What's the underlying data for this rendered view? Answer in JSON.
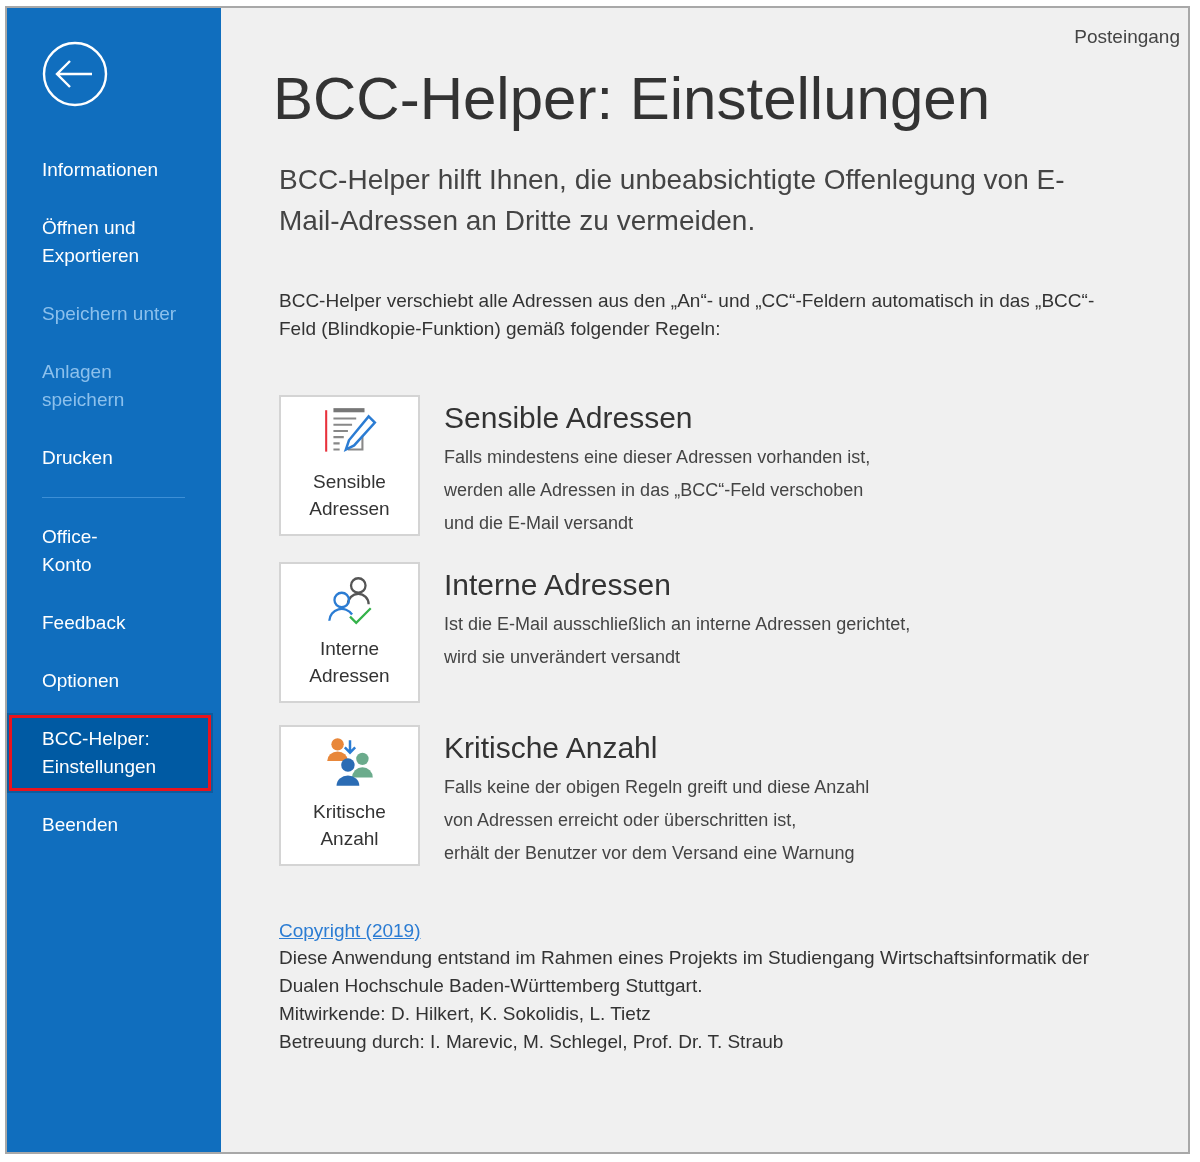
{
  "sidebar": {
    "items": [
      {
        "kind": "item",
        "label": "Informationen",
        "disabled": false,
        "selected": false
      },
      {
        "kind": "item",
        "label": "Öffnen und\nExportieren",
        "disabled": false,
        "selected": false
      },
      {
        "kind": "item",
        "label": "Speichern unter",
        "disabled": true,
        "selected": false
      },
      {
        "kind": "item",
        "label": "Anlagen\nspeichern",
        "disabled": true,
        "selected": false
      },
      {
        "kind": "item",
        "label": "Drucken",
        "disabled": false,
        "selected": false
      },
      {
        "kind": "divider"
      },
      {
        "kind": "item",
        "label": "Office-\nKonto",
        "disabled": false,
        "selected": false
      },
      {
        "kind": "item",
        "label": "Feedback",
        "disabled": false,
        "selected": false
      },
      {
        "kind": "item",
        "label": "Optionen",
        "disabled": false,
        "selected": false
      },
      {
        "kind": "item",
        "label": "BCC-Helper:\nEinstellungen",
        "disabled": false,
        "selected": true
      },
      {
        "kind": "item",
        "label": "Beenden",
        "disabled": false,
        "selected": false
      }
    ]
  },
  "breadcrumb": "Posteingang",
  "title": "BCC-Helper: Einstellungen",
  "subtitle": "BCC-Helper hilft Ihnen, die unbeabsichtigte Offenlegung von E-\nMail-Adressen an Dritte zu vermeiden.",
  "intro": "BCC-Helper verschiebt alle Adressen aus den „An“- und „CC“-Feldern automatisch in das „BCC“-\nFeld (Blindkopie-Funktion) gemäß folgender Regeln:",
  "rules": [
    {
      "kind": "sensitive",
      "button": "Sensible\nAdressen",
      "heading": "Sensible Adressen",
      "description": "Falls mindestens eine dieser Adressen vorhanden ist,\nwerden alle Adressen in das „BCC“-Feld verschoben\nund die E-Mail versandt"
    },
    {
      "kind": "internal",
      "button": "Interne\nAdressen",
      "heading": "Interne Adressen",
      "description": "Ist die E-Mail ausschließlich an interne Adressen gerichtet,\nwird sie unverändert versandt"
    },
    {
      "kind": "critical",
      "button": "Kritische\nAnzahl",
      "heading": "Kritische Anzahl",
      "description": "Falls keine der obigen Regeln greift und diese Anzahl\nvon Adressen erreicht oder überschritten ist,\nerhält der Benutzer vor dem Versand eine Warnung"
    }
  ],
  "footer": {
    "link": "Copyright (2019)",
    "text": "Diese Anwendung entstand im Rahmen eines Projekts im Studiengang Wirtschaftsinformatik der\nDualen Hochschule Baden-Württemberg Stuttgart.\nMitwirkende: D. Hilkert, K. Sokolidis, L. Tietz\nBetreuung durch: I. Marevic, M. Schlegel, Prof. Dr. T. Straub"
  }
}
